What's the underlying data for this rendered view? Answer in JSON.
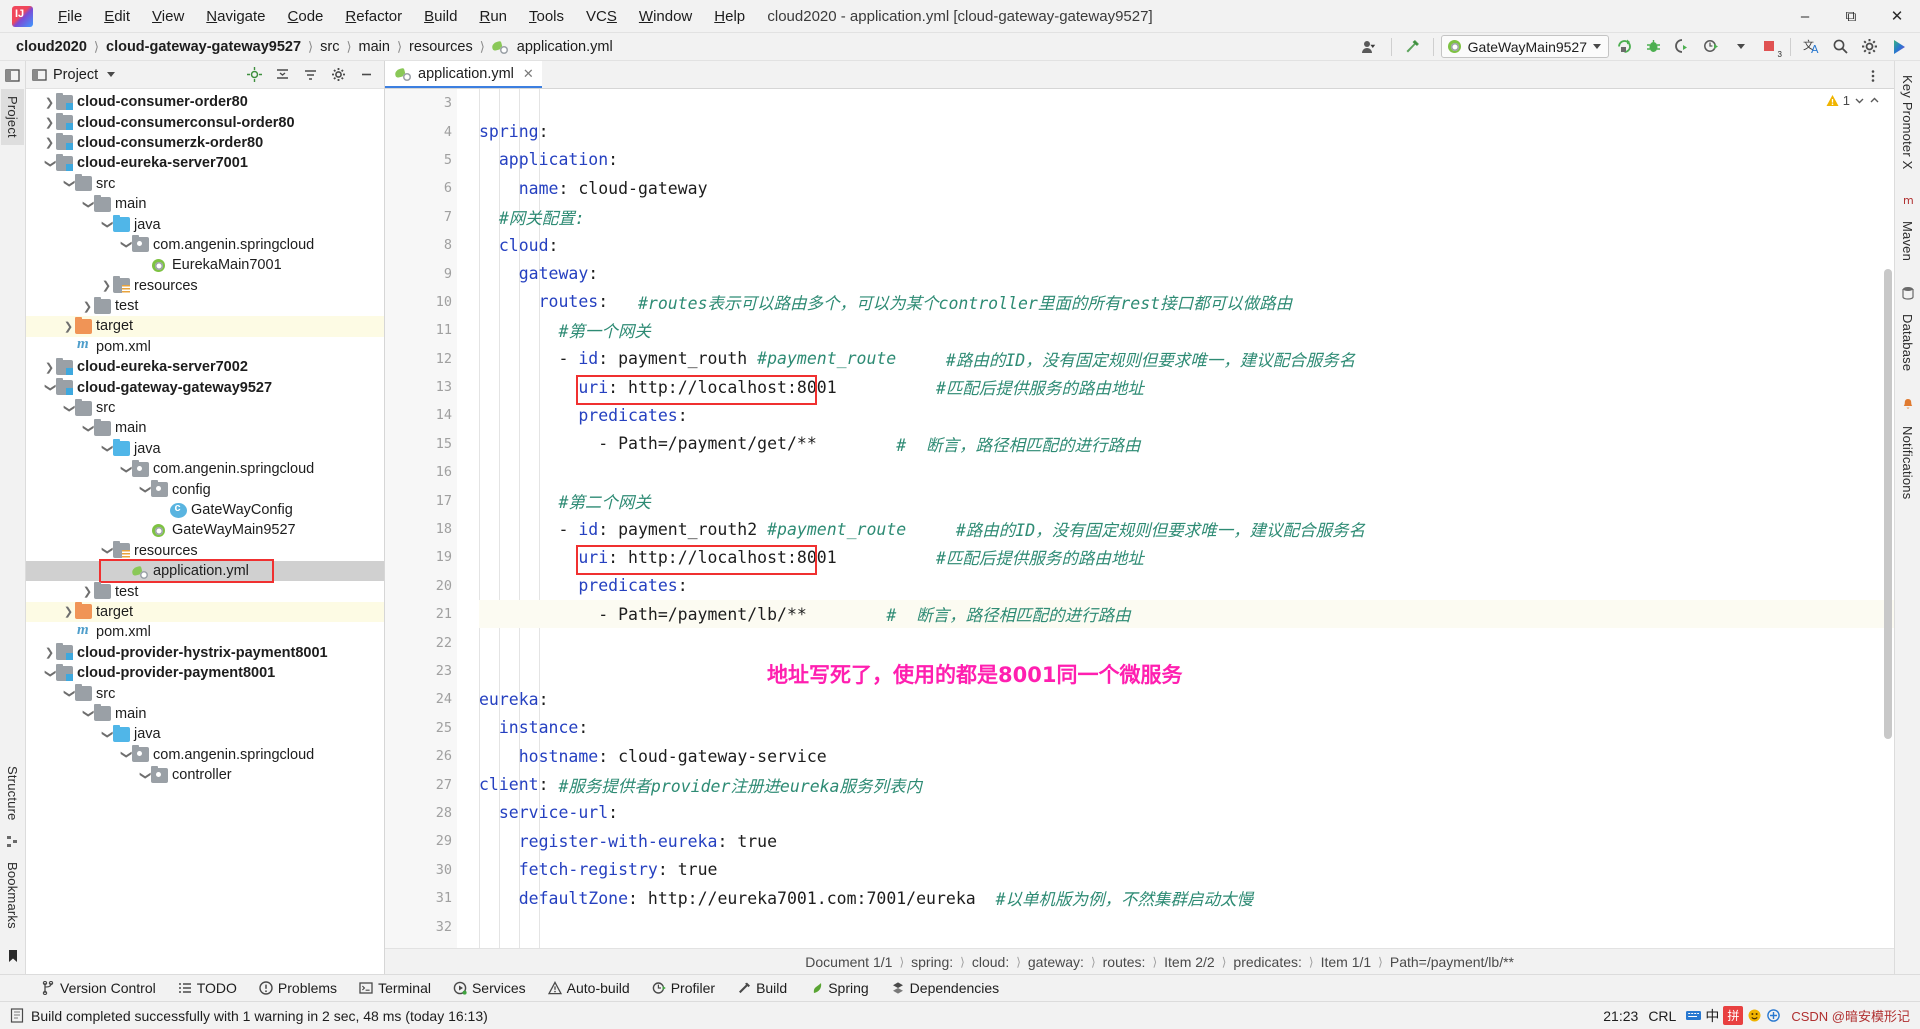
{
  "window": {
    "title": "cloud2020 - application.yml [cloud-gateway-gateway9527]",
    "minimize": "–",
    "maximize": "❐",
    "close": "✕"
  },
  "menubar": [
    "File",
    "Edit",
    "View",
    "Navigate",
    "Code",
    "Refactor",
    "Build",
    "Run",
    "Tools",
    "VCS",
    "Window",
    "Help"
  ],
  "navbar": {
    "crumbs": [
      "cloud2020",
      "cloud-gateway-gateway9527",
      "src",
      "main",
      "resources",
      "application.yml"
    ],
    "run_config": "GateWayMain9527",
    "icons": [
      "user-settings-icon",
      "hammer-icon",
      "run-icon",
      "debug-icon",
      "coverage-icon",
      "profile-icon",
      "stop-icon",
      "translate-icon",
      "search-icon",
      "gear-icon",
      "updates-icon"
    ],
    "error_badge": "3"
  },
  "left_rail": {
    "tabs": [
      "Project",
      "Bookmarks",
      "Structure"
    ],
    "active": "Project"
  },
  "right_rail": {
    "tabs": [
      "Key Promoter X",
      "Maven",
      "Database",
      "Notifications"
    ]
  },
  "project_panel": {
    "title": "Project",
    "toolbar_icons": [
      "locate-icon",
      "collapse-all-icon",
      "expand-icon",
      "gear-icon",
      "hide-icon"
    ],
    "tree": [
      {
        "label": "cloud-consumer-order80",
        "depth": 1,
        "arrow": "collapsed",
        "icon": "module-folder-icon",
        "bold": true
      },
      {
        "label": "cloud-consumerconsul-order80",
        "depth": 1,
        "arrow": "collapsed",
        "icon": "module-folder-icon",
        "bold": true
      },
      {
        "label": "cloud-consumerzk-order80",
        "depth": 1,
        "arrow": "collapsed",
        "icon": "module-folder-icon",
        "bold": true
      },
      {
        "label": "cloud-eureka-server7001",
        "depth": 1,
        "arrow": "expanded",
        "icon": "module-folder-icon",
        "bold": true
      },
      {
        "label": "src",
        "depth": 2,
        "arrow": "expanded",
        "icon": "folder-icon"
      },
      {
        "label": "main",
        "depth": 3,
        "arrow": "expanded",
        "icon": "folder-icon"
      },
      {
        "label": "java",
        "depth": 4,
        "arrow": "expanded",
        "icon": "source-folder-icon"
      },
      {
        "label": "com.angenin.springcloud",
        "depth": 5,
        "arrow": "expanded",
        "icon": "package-icon"
      },
      {
        "label": "EurekaMain7001",
        "depth": 6,
        "arrow": "none",
        "icon": "spring-class-icon"
      },
      {
        "label": "resources",
        "depth": 4,
        "arrow": "collapsed",
        "icon": "resources-folder-icon"
      },
      {
        "label": "test",
        "depth": 3,
        "arrow": "collapsed",
        "icon": "folder-icon"
      },
      {
        "label": "target",
        "depth": 2,
        "arrow": "collapsed",
        "icon": "target-folder-icon",
        "row": "target"
      },
      {
        "label": "pom.xml",
        "depth": 2,
        "arrow": "none",
        "icon": "maven-icon"
      },
      {
        "label": "cloud-eureka-server7002",
        "depth": 1,
        "arrow": "collapsed",
        "icon": "module-folder-icon",
        "bold": true
      },
      {
        "label": "cloud-gateway-gateway9527",
        "depth": 1,
        "arrow": "expanded",
        "icon": "module-folder-icon",
        "bold": true
      },
      {
        "label": "src",
        "depth": 2,
        "arrow": "expanded",
        "icon": "folder-icon"
      },
      {
        "label": "main",
        "depth": 3,
        "arrow": "expanded",
        "icon": "folder-icon"
      },
      {
        "label": "java",
        "depth": 4,
        "arrow": "expanded",
        "icon": "source-folder-icon"
      },
      {
        "label": "com.angenin.springcloud",
        "depth": 5,
        "arrow": "expanded",
        "icon": "package-icon"
      },
      {
        "label": "config",
        "depth": 6,
        "arrow": "expanded",
        "icon": "package-icon"
      },
      {
        "label": "GateWayConfig",
        "depth": 7,
        "arrow": "none",
        "icon": "class-icon"
      },
      {
        "label": "GateWayMain9527",
        "depth": 6,
        "arrow": "none",
        "icon": "spring-class-icon"
      },
      {
        "label": "resources",
        "depth": 4,
        "arrow": "expanded",
        "icon": "resources-folder-icon"
      },
      {
        "label": "application.yml",
        "depth": 5,
        "arrow": "none",
        "icon": "yml-icon",
        "row": "selected",
        "boxed": true
      },
      {
        "label": "test",
        "depth": 3,
        "arrow": "collapsed",
        "icon": "folder-icon"
      },
      {
        "label": "target",
        "depth": 2,
        "arrow": "collapsed",
        "icon": "target-folder-icon",
        "row": "target"
      },
      {
        "label": "pom.xml",
        "depth": 2,
        "arrow": "none",
        "icon": "maven-icon"
      },
      {
        "label": "cloud-provider-hystrix-payment8001",
        "depth": 1,
        "arrow": "collapsed",
        "icon": "module-folder-icon",
        "bold": true
      },
      {
        "label": "cloud-provider-payment8001",
        "depth": 1,
        "arrow": "expanded",
        "icon": "module-folder-icon",
        "bold": true
      },
      {
        "label": "src",
        "depth": 2,
        "arrow": "expanded",
        "icon": "folder-icon"
      },
      {
        "label": "main",
        "depth": 3,
        "arrow": "expanded",
        "icon": "folder-icon"
      },
      {
        "label": "java",
        "depth": 4,
        "arrow": "expanded",
        "icon": "source-folder-icon"
      },
      {
        "label": "com.angenin.springcloud",
        "depth": 5,
        "arrow": "expanded",
        "icon": "package-icon"
      },
      {
        "label": "controller",
        "depth": 6,
        "arrow": "expanded",
        "icon": "package-icon"
      }
    ]
  },
  "editor": {
    "tab": {
      "label": "application.yml",
      "icon": "yml-icon",
      "close": "✕"
    },
    "warning_count": "1",
    "first_line_number": 3,
    "lines": [
      {
        "n": 3,
        "segs": []
      },
      {
        "n": 4,
        "fold": "end",
        "segs": [
          {
            "t": "key",
            "v": "spring"
          },
          {
            "t": "punct",
            "v": ":"
          }
        ]
      },
      {
        "n": 5,
        "fold": "end",
        "segs": [
          {
            "t": "punct",
            "v": "  "
          },
          {
            "t": "key",
            "v": "application"
          },
          {
            "t": "punct",
            "v": ":"
          }
        ]
      },
      {
        "n": 6,
        "fold": "last",
        "segs": [
          {
            "t": "punct",
            "v": "    "
          },
          {
            "t": "key",
            "v": "name"
          },
          {
            "t": "punct",
            "v": ": "
          },
          {
            "t": "kval",
            "v": "cloud-gateway"
          }
        ]
      },
      {
        "n": 7,
        "segs": [
          {
            "t": "punct",
            "v": "  "
          },
          {
            "t": "cmt",
            "v": "#网关配置:"
          }
        ]
      },
      {
        "n": 8,
        "fold": "end",
        "segs": [
          {
            "t": "punct",
            "v": "  "
          },
          {
            "t": "key",
            "v": "cloud"
          },
          {
            "t": "punct",
            "v": ":"
          }
        ]
      },
      {
        "n": 9,
        "fold": "end",
        "segs": [
          {
            "t": "punct",
            "v": "    "
          },
          {
            "t": "key",
            "v": "gateway"
          },
          {
            "t": "punct",
            "v": ":"
          }
        ]
      },
      {
        "n": 10,
        "fold": "end",
        "segs": [
          {
            "t": "punct",
            "v": "      "
          },
          {
            "t": "key",
            "v": "routes"
          },
          {
            "t": "punct",
            "v": ":   "
          },
          {
            "t": "cmt",
            "v": "#routes表示可以路由多个，可以为某个controller里面的所有rest接口都可以做路由"
          }
        ]
      },
      {
        "n": 11,
        "segs": [
          {
            "t": "punct",
            "v": "        "
          },
          {
            "t": "cmt",
            "v": "#第一个网关"
          }
        ]
      },
      {
        "n": 12,
        "fold": "end",
        "segs": [
          {
            "t": "punct",
            "v": "        - "
          },
          {
            "t": "key",
            "v": "id"
          },
          {
            "t": "punct",
            "v": ": "
          },
          {
            "t": "kval",
            "v": "payment_routh "
          },
          {
            "t": "cmt",
            "v": "#payment_route"
          },
          {
            "t": "punct",
            "v": "     "
          },
          {
            "t": "cmt",
            "v": "#路由的ID，没有固定规则但要求唯一，建议配合服务名"
          }
        ]
      },
      {
        "n": 13,
        "segs": [
          {
            "t": "punct",
            "v": "          "
          },
          {
            "t": "key",
            "v": "uri"
          },
          {
            "t": "punct",
            "v": ": "
          },
          {
            "t": "kval",
            "v": "http://localhost:8001"
          },
          {
            "t": "punct",
            "v": "          "
          },
          {
            "t": "cmt",
            "v": "#匹配后提供服务的路由地址"
          }
        ]
      },
      {
        "n": 14,
        "fold": "end",
        "segs": [
          {
            "t": "punct",
            "v": "          "
          },
          {
            "t": "key",
            "v": "predicates"
          },
          {
            "t": "punct",
            "v": ":"
          }
        ]
      },
      {
        "n": 15,
        "fold": "last",
        "segs": [
          {
            "t": "punct",
            "v": "            - "
          },
          {
            "t": "kval",
            "v": "Path=/payment/get/**"
          },
          {
            "t": "punct",
            "v": "        "
          },
          {
            "t": "cmt",
            "v": "#  断言，路径相匹配的进行路由"
          }
        ]
      },
      {
        "n": 16,
        "segs": []
      },
      {
        "n": 17,
        "segs": [
          {
            "t": "punct",
            "v": "        "
          },
          {
            "t": "cmt",
            "v": "#第二个网关"
          }
        ]
      },
      {
        "n": 18,
        "fold": "end",
        "segs": [
          {
            "t": "punct",
            "v": "        - "
          },
          {
            "t": "key",
            "v": "id"
          },
          {
            "t": "punct",
            "v": ": "
          },
          {
            "t": "kval",
            "v": "payment_routh2 "
          },
          {
            "t": "cmt",
            "v": "#payment_route"
          },
          {
            "t": "punct",
            "v": "     "
          },
          {
            "t": "cmt",
            "v": "#路由的ID，没有固定规则但要求唯一，建议配合服务名"
          }
        ]
      },
      {
        "n": 19,
        "segs": [
          {
            "t": "punct",
            "v": "          "
          },
          {
            "t": "key",
            "v": "uri"
          },
          {
            "t": "punct",
            "v": ": "
          },
          {
            "t": "kval",
            "v": "http://localhost:8001"
          },
          {
            "t": "punct",
            "v": "          "
          },
          {
            "t": "cmt",
            "v": "#匹配后提供服务的路由地址"
          }
        ]
      },
      {
        "n": 20,
        "fold": "end",
        "segs": [
          {
            "t": "punct",
            "v": "          "
          },
          {
            "t": "key",
            "v": "predicates"
          },
          {
            "t": "punct",
            "v": ":"
          }
        ]
      },
      {
        "n": 21,
        "fold": "last",
        "bulb": true,
        "hl": true,
        "segs": [
          {
            "t": "punct",
            "v": "            - "
          },
          {
            "t": "kval",
            "v": "Path=/payment/lb/**"
          },
          {
            "t": "punct",
            "v": "        "
          },
          {
            "t": "cmt",
            "v": "#  断言，路径相匹配的进行路由"
          }
        ]
      },
      {
        "n": 22,
        "segs": []
      },
      {
        "n": 23,
        "segs": []
      },
      {
        "n": 24,
        "fold": "end",
        "segs": [
          {
            "t": "key",
            "v": "eureka"
          },
          {
            "t": "punct",
            "v": ":"
          }
        ]
      },
      {
        "n": 25,
        "fold": "end",
        "segs": [
          {
            "t": "punct",
            "v": "  "
          },
          {
            "t": "key",
            "v": "instance"
          },
          {
            "t": "punct",
            "v": ":"
          }
        ]
      },
      {
        "n": 26,
        "fold": "last",
        "segs": [
          {
            "t": "punct",
            "v": "    "
          },
          {
            "t": "key",
            "v": "hostname"
          },
          {
            "t": "punct",
            "v": ": "
          },
          {
            "t": "kval",
            "v": "cloud-gateway-service"
          }
        ]
      },
      {
        "n": 27,
        "fold": "end",
        "segs": [
          {
            "t": "key",
            "v": "client"
          },
          {
            "t": "punct",
            "v": ": "
          },
          {
            "t": "cmt",
            "v": "#服务提供者provider注册进eureka服务列表内"
          }
        ]
      },
      {
        "n": 28,
        "fold": "end",
        "segs": [
          {
            "t": "punct",
            "v": "  "
          },
          {
            "t": "key",
            "v": "service-url"
          },
          {
            "t": "punct",
            "v": ":"
          }
        ]
      },
      {
        "n": 29,
        "segs": [
          {
            "t": "punct",
            "v": "    "
          },
          {
            "t": "key",
            "v": "register-with-eureka"
          },
          {
            "t": "punct",
            "v": ": "
          },
          {
            "t": "kval",
            "v": "true"
          }
        ]
      },
      {
        "n": 30,
        "segs": [
          {
            "t": "punct",
            "v": "    "
          },
          {
            "t": "key",
            "v": "fetch-registry"
          },
          {
            "t": "punct",
            "v": ": "
          },
          {
            "t": "kval",
            "v": "true"
          }
        ]
      },
      {
        "n": 31,
        "segs": [
          {
            "t": "punct",
            "v": "    "
          },
          {
            "t": "key",
            "v": "defaultZone"
          },
          {
            "t": "punct",
            "v": ": "
          },
          {
            "t": "kval",
            "v": "http://eureka7001.com:7001/eureka"
          },
          {
            "t": "punct",
            "v": "  "
          },
          {
            "t": "cmt",
            "v": "#以单机版为例，不然集群启动太慢"
          }
        ]
      },
      {
        "n": 32,
        "segs": []
      }
    ],
    "annotation": "地址写死了，使用的都是8001同一个微服务",
    "annotation_color": "#ff1fb0",
    "highlight_color": "#f03030"
  },
  "doc_breadcrumb": [
    "Document 1/1",
    "spring:",
    "cloud:",
    "gateway:",
    "routes:",
    "Item 2/2",
    "predicates:",
    "Item 1/1",
    "Path=/payment/lb/**"
  ],
  "tool_window_bar": [
    {
      "label": "Version Control",
      "icon": "branch-icon"
    },
    {
      "label": "TODO",
      "icon": "list-icon"
    },
    {
      "label": "Problems",
      "icon": "problems-icon"
    },
    {
      "label": "Terminal",
      "icon": "terminal-icon"
    },
    {
      "label": "Services",
      "icon": "services-icon"
    },
    {
      "label": "Auto-build",
      "icon": "warning-triangle-icon"
    },
    {
      "label": "Profiler",
      "icon": "profiler-icon"
    },
    {
      "label": "Build",
      "icon": "hammer-icon"
    },
    {
      "label": "Spring",
      "icon": "spring-leaf-icon"
    },
    {
      "label": "Dependencies",
      "icon": "dependencies-icon"
    }
  ],
  "statusbar": {
    "message": "Build completed successfully with 1 warning in 2 sec, 48 ms (today 16:13)",
    "message_icon": "build-log-icon",
    "time": "21:23",
    "encoding": "CRL",
    "ime_lang": "中",
    "ime_badge": "拼",
    "watermark": "CSDN @暗安模形记"
  }
}
